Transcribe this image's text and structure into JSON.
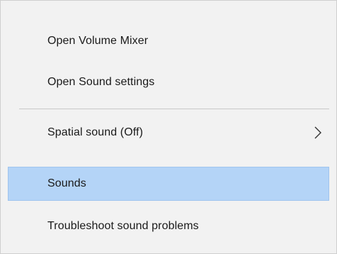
{
  "context_menu": {
    "items": [
      {
        "label": "Open Volume Mixer"
      },
      {
        "label": "Open Sound settings"
      },
      {
        "label": "Spatial sound (Off)",
        "has_submenu": true,
        "submenu_icon": "chevron-right-icon"
      },
      {
        "label": "Sounds",
        "highlighted": true
      },
      {
        "label": "Troubleshoot sound problems"
      }
    ],
    "colors": {
      "background": "#f2f2f2",
      "highlight": "#b4d4f7",
      "highlight_border": "#9fc4ee",
      "separator": "#c8c8c8",
      "text": "#1a1a1a"
    }
  }
}
